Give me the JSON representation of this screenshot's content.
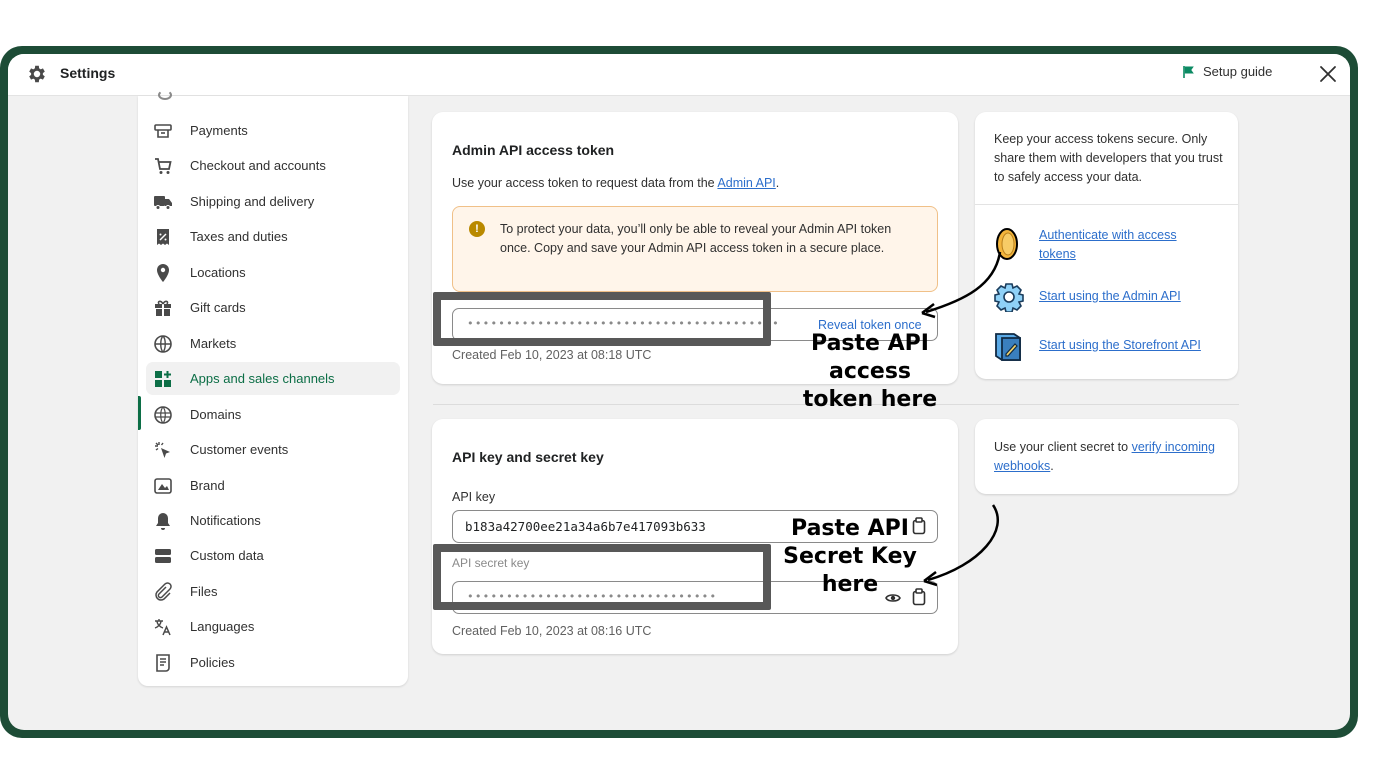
{
  "topbar": {
    "title": "Settings",
    "setup_guide": "Setup guide",
    "gear_icon": "gear-icon",
    "flag_icon": "flag-icon",
    "close_icon": "close-icon",
    "flag_color": "#0c8a63"
  },
  "sidebar": {
    "items": [
      {
        "label": "Payments",
        "icon": "payments-icon"
      },
      {
        "label": "Checkout and accounts",
        "icon": "cart-icon"
      },
      {
        "label": "Shipping and delivery",
        "icon": "truck-icon"
      },
      {
        "label": "Taxes and duties",
        "icon": "receipt-icon"
      },
      {
        "label": "Locations",
        "icon": "location-pin-icon"
      },
      {
        "label": "Gift cards",
        "icon": "gift-icon"
      },
      {
        "label": "Markets",
        "icon": "globe-icon"
      },
      {
        "label": "Apps and sales channels",
        "icon": "apps-icon"
      },
      {
        "label": "Domains",
        "icon": "domains-icon"
      },
      {
        "label": "Customer events",
        "icon": "cursor-click-icon"
      },
      {
        "label": "Brand",
        "icon": "brand-icon"
      },
      {
        "label": "Notifications",
        "icon": "bell-icon"
      },
      {
        "label": "Custom data",
        "icon": "custom-data-icon"
      },
      {
        "label": "Files",
        "icon": "paperclip-icon"
      },
      {
        "label": "Languages",
        "icon": "translate-icon"
      },
      {
        "label": "Policies",
        "icon": "policy-icon"
      }
    ],
    "active_index": 7,
    "active_color": "#0c6e46"
  },
  "admin_token": {
    "title": "Admin API access token",
    "desc_prefix": "Use your access token to request data from the ",
    "desc_link": "Admin API",
    "desc_suffix": ".",
    "warning": "To protect your data, you’ll only be able to reveal your Admin API token once. Copy and save your Admin API access token in a secure place.",
    "token_mask": "••••••••••••••••••••••••••••••••••••••••",
    "reveal": "Reveal token once",
    "created": "Created Feb 10, 2023 at 08:18 UTC"
  },
  "tips": {
    "text": "Keep your access tokens secure. Only share them with developers that you trust to safely access your data.",
    "links": [
      "Authenticate with access tokens",
      "Start using the Admin API",
      "Start using the Storefront API"
    ]
  },
  "api_keys": {
    "title": "API key and secret key",
    "api_key_label": "API key",
    "api_key_value": "b183a42700ee21a34a6b7e417093b633",
    "secret_label": "API secret key",
    "secret_mask": "••••••••••••••••••••••••••••••••",
    "created": "Created Feb 10, 2023 at 08:16 UTC"
  },
  "secret_help": {
    "prefix": "Use your client secret to ",
    "link": "verify incoming webhooks",
    "suffix": "."
  },
  "annotations": {
    "token_line1": "Paste API access",
    "token_line2": "token here",
    "secret_line1": "Paste API",
    "secret_line2": "Secret Key",
    "secret_line3": "here"
  }
}
